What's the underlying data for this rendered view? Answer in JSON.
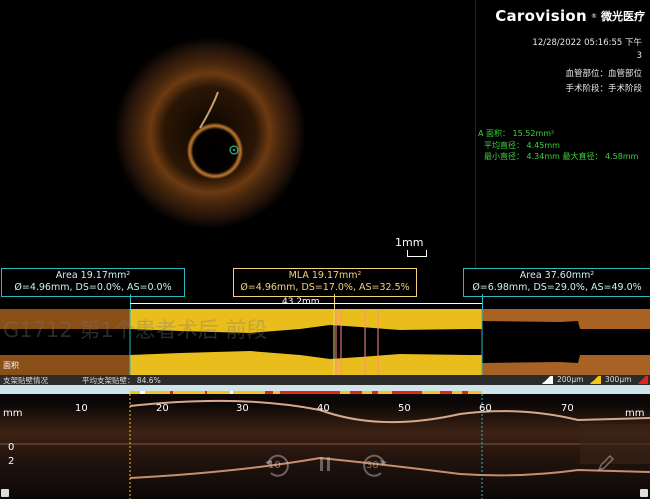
{
  "brand": {
    "name": "Carovision",
    "registered": "®",
    "cn": "微光医疗"
  },
  "info": {
    "datetime": "12/28/2022 05:16:55 下午",
    "frame": "3",
    "vessel": "血管部位：血管部位",
    "phase": "手术阶段：手术阶段"
  },
  "measurements": {
    "area": "A  面积：  15.52mm²",
    "avg_diam": "平均直径：  4.45mm",
    "min_max": "最小直径：  4.34mm    最大直径：  4.58mm"
  },
  "scale": {
    "label": "1mm"
  },
  "callouts": [
    {
      "line1": "Area 19.17mm²",
      "line2": "Ø=4.96mm, DS=0.0%, AS=0.0%"
    },
    {
      "line1": "MLA 19.17mm²",
      "line2": "Ø=4.96mm, DS=17.0%, AS=32.5%"
    },
    {
      "line1": "Area 37.60mm²",
      "line2": "Ø=6.98mm, DS=29.0%, AS=49.0%"
    }
  ],
  "length_measure": "43.2mm",
  "watermark": "G1712 第1个患者术后 前段",
  "lumen_label": "面积",
  "apposition": {
    "title": "支架贴壁情况",
    "avg": "平均支架贴壁： 84.6%",
    "legend_200": "200μm",
    "legend_300": "300μm"
  },
  "long_axis": {
    "unit": "mm",
    "ticks": [
      "10",
      "20",
      "30",
      "40",
      "50",
      "60",
      "70"
    ],
    "depth_ticks": [
      "0",
      "2"
    ],
    "rewind_label": "10",
    "forward_label": "30"
  },
  "colors": {
    "accent": "#2bb9c2",
    "stent": "#f2c41c",
    "vessel": "#b5752e",
    "alert": "#e8221a",
    "measure": "#3ed13e"
  }
}
